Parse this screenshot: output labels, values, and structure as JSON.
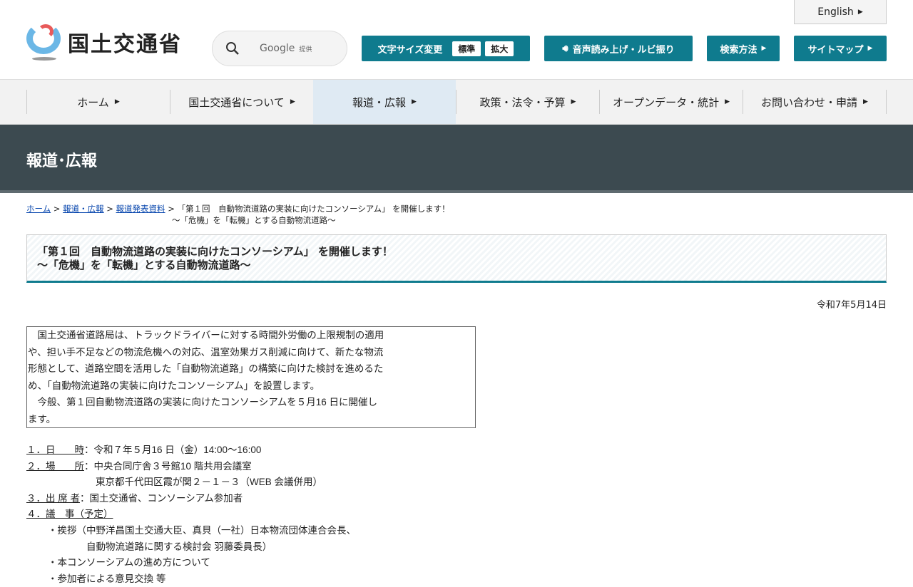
{
  "header": {
    "logo": "国土交通省",
    "search_brand": "Google",
    "search_provided": "提供",
    "english": "English",
    "font_size_label": "文字サイズ変更",
    "font_standard": "標準",
    "font_large": "拡大",
    "speech": "音声読み上げ・ルビ振り",
    "search_method": "検索方法",
    "sitemap": "サイトマップ"
  },
  "nav": [
    "ホーム",
    "国土交通省について",
    "報道・広報",
    "政策・法令・予算",
    "オープンデータ・統計",
    "お問い合わせ・申請"
  ],
  "banner": "報道･広報",
  "breadcrumb": {
    "home": "ホーム",
    "press": "報道・広報",
    "releases": "報道発表資料",
    "current_1": "「第１回　自動物流道路の実装に向けたコンソーシアム」 を開催します！",
    "current_2": "～「危機」を「転機」とする自動物流道路～"
  },
  "title": {
    "line1": "「第１回　自動物流道路の実装に向けたコンソーシアム」 を開催します！",
    "line2": "～「危機」を「転機」とする自動物流道路～"
  },
  "date": "令和7年5月14日",
  "lead": [
    "　国土交通省道路局は、トラックドライバーに対する時間外労働の上限規制の適用",
    "や、担い手不足などの物流危機への対応、温室効果ガス削減に向けて、新たな物流",
    "形態として、道路空間を活用した「自動物流道路」の構築に向けた検討を進めるた",
    "め、「自動物流道路の実装に向けたコンソーシアム」を設置します。",
    "　今般、第１回自動物流道路の実装に向けたコンソーシアムを５月16 日に開催し",
    "ます。"
  ],
  "items": {
    "date_label": "１．日　　時",
    "date_value": "：令和７年５月16 日（金）14:00～16:00",
    "place_label": "２．場　　所",
    "place_value": "：中央合同庁舎３号館10 階共用会議室",
    "place_value2": "東京都千代田区霞が関２－１－３（WEB 会議併用）",
    "attend_label": "３．出 席 者",
    "attend_value": "：国土交通省、コンソーシアム参加者",
    "agenda_label": "４．議　事（予定）",
    "agenda": [
      "・挨拶（中野洋昌国土交通大臣、真貝（一社）日本物流団体連合会長、",
      "自動物流道路に関する検討会 羽藤委員長）",
      "・本コンソーシアムの進め方について",
      "・参加者による意見交換 等"
    ]
  }
}
